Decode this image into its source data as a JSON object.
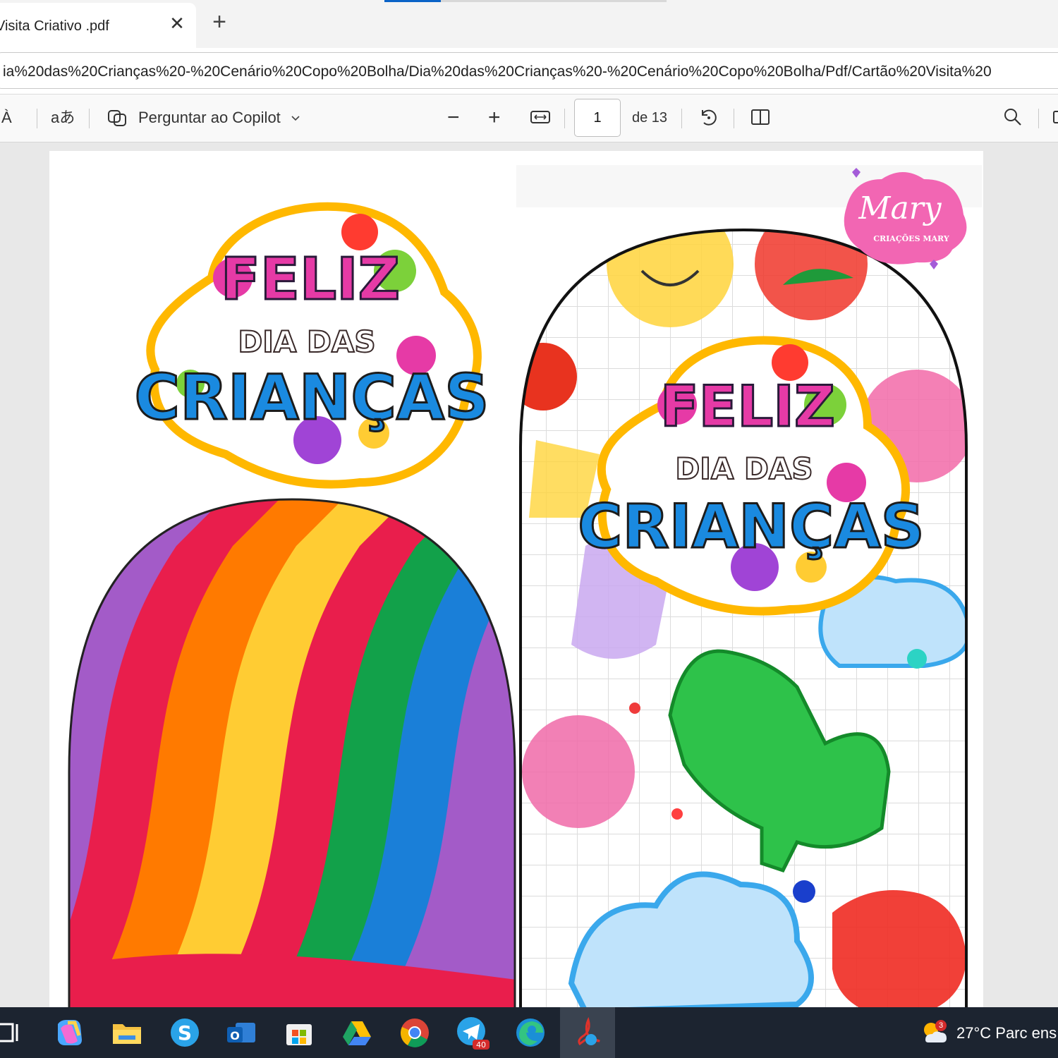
{
  "tab": {
    "title": "Visita Criativo .pdf",
    "close": "✕",
    "new": "+"
  },
  "address": {
    "url": "ia%20das%20Crianças%20-%20Cenário%20Copo%20Bolha/Dia%20das%20Crianças%20-%20Cenário%20Copo%20Bolha/Pdf/Cartão%20Visita%20"
  },
  "pdf_toolbar": {
    "read_aloud": "À",
    "translate": "aあ",
    "copilot_label": "Perguntar ao Copilot",
    "zoom_out": "−",
    "zoom_in": "+",
    "page_current": "1",
    "page_total": "de 13"
  },
  "document": {
    "logo": {
      "line1": "FELIZ",
      "line2": "DIA DAS",
      "line3": "CRIANÇAS"
    },
    "brand": {
      "name": "Mary",
      "sub": "CRIAÇÕES MARY"
    },
    "colors": {
      "rainbow": [
        "#e91e4c",
        "#ff7a00",
        "#ffcc33",
        "#12a14a",
        "#1a7fd8",
        "#a35bc8"
      ]
    }
  },
  "taskbar": {
    "weather": "27°C  Parc ens",
    "weather_badge": "3",
    "telegram_badge": "40",
    "icons": [
      "task-view-icon",
      "copilot-icon",
      "file-explorer-icon",
      "skype-icon",
      "outlook-icon",
      "store-icon",
      "google-drive-icon",
      "chrome-icon",
      "telegram-icon",
      "edge-icon",
      "acrobat-icon"
    ]
  }
}
